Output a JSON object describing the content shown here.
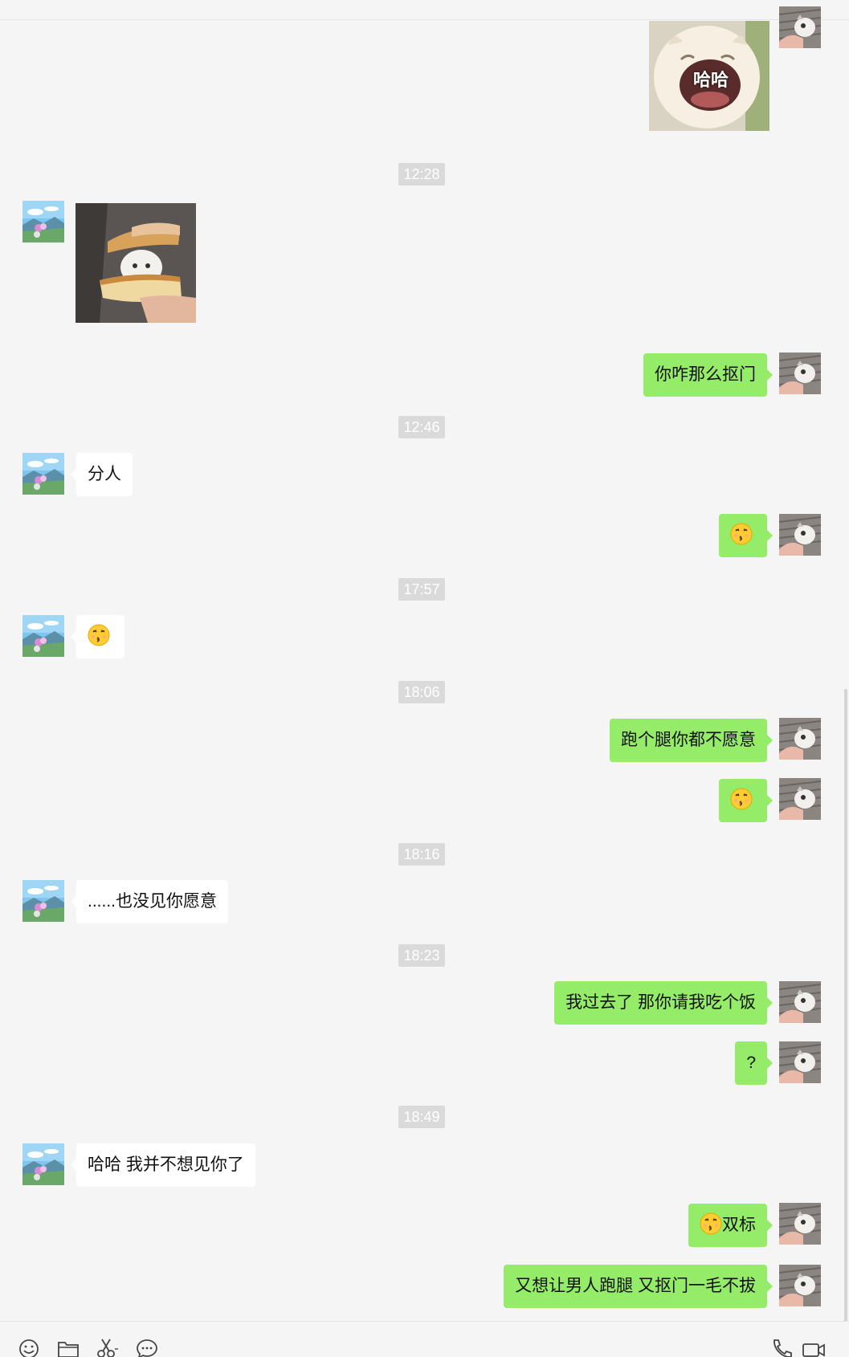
{
  "messages": {
    "t1228": "12:28",
    "t1246": "12:46",
    "t1757": "17:57",
    "t1806": "18:06",
    "t1816": "18:16",
    "t1823": "18:23",
    "t1849": "18:49",
    "m_zamenkoumen": "你咋那么抠门",
    "m_fenren": "分人",
    "m_paotui": "跑个腿你都不愿意",
    "m_yemei": "......也没见你愿意",
    "m_woguoqu": "我过去了 那你请我吃个饭",
    "m_question": "?",
    "m_haha": "哈哈 我并不想见你了",
    "m_shuangbiao": "双标",
    "m_youxiang": "又想让男人跑腿 又抠门一毛不拔",
    "sticker_text": "哈哈"
  },
  "icons": {
    "emoji": "kissing-face-icon",
    "toolbar": [
      "emoji-icon",
      "folder-icon",
      "scissors-icon",
      "chat-bubble-icon",
      "phone-icon",
      "video-icon"
    ]
  },
  "colors": {
    "outgoing_bubble": "#95ec69",
    "incoming_bubble": "#ffffff",
    "background": "#f5f5f5",
    "timestamp_bg": "#dadada"
  }
}
